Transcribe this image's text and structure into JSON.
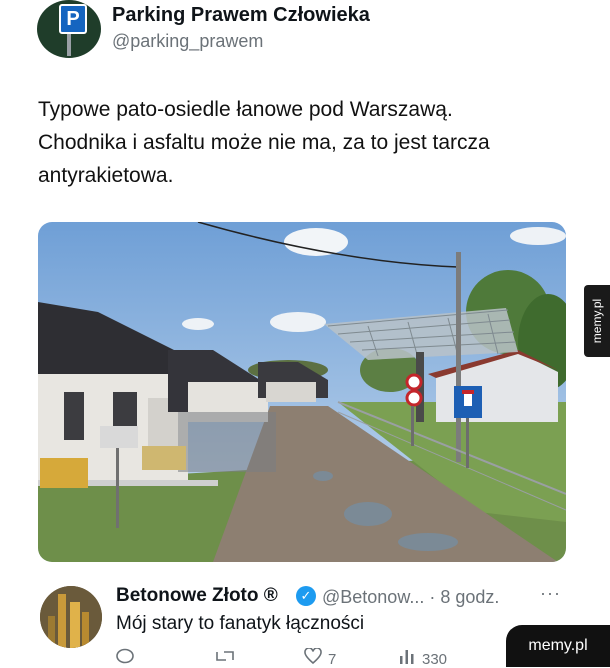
{
  "top_tweet": {
    "avatar_letter": "P",
    "name": "Parking Prawem Człowieka",
    "handle": "@parking_prawem",
    "text_lines": [
      "Typowe pato-osiedle łanowe pod Warszawą.",
      "Chodnika i asfaltu może nie ma, za to jest tarcza",
      "antyrakietowa."
    ]
  },
  "watermark_side": "memy.pl",
  "reply": {
    "name": "Betonowe Złoto ®",
    "handle": "@Betonow...",
    "separator": "·",
    "time": "8 godz.",
    "more": "···",
    "text": "Mój stary to fanatyk łączności"
  },
  "actions": {
    "reply_icon": "reply-icon",
    "retweet_icon": "retweet-icon",
    "like_icon": "heart-icon",
    "like_count": "7",
    "views_icon": "views-icon",
    "views_count": "330"
  },
  "badge": "memy.pl"
}
